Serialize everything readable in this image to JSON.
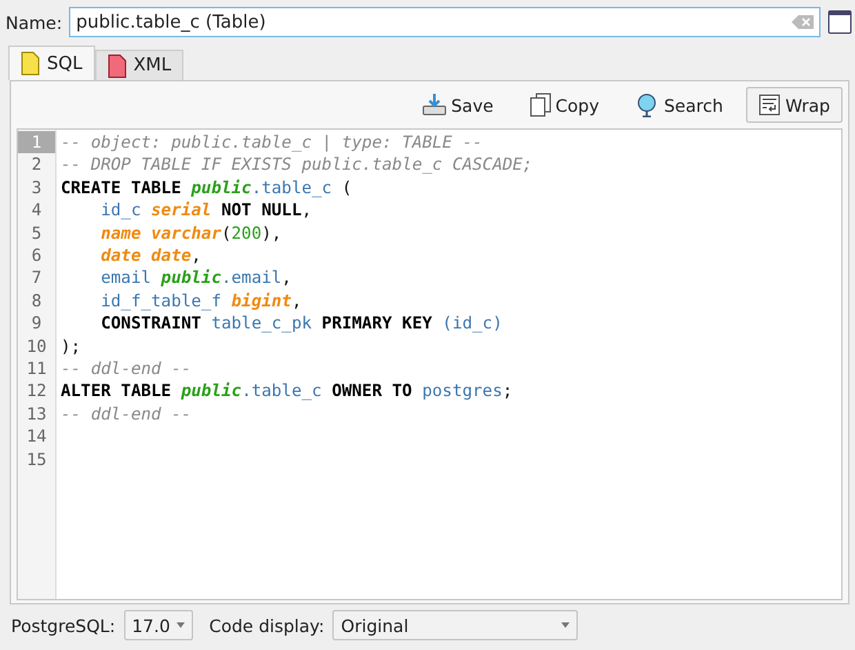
{
  "name_field": {
    "label": "Name:",
    "value": "public.table_c (Table)"
  },
  "tabs": [
    {
      "label": "SQL",
      "selected": true,
      "kind": "sql"
    },
    {
      "label": "XML",
      "selected": false,
      "kind": "xml"
    }
  ],
  "toolbar": [
    {
      "label": "Save",
      "kind": "save",
      "pressed": false
    },
    {
      "label": "Copy",
      "kind": "copy",
      "pressed": false
    },
    {
      "label": "Search",
      "kind": "search",
      "pressed": false
    },
    {
      "label": "Wrap",
      "kind": "wrap",
      "pressed": true
    }
  ],
  "code": {
    "lines": [
      {
        "number": "1",
        "selected": true,
        "tokens": [
          {
            "kind": "comment",
            "text": "-- object: public.table_c | type: TABLE --"
          }
        ]
      },
      {
        "number": "2",
        "selected": false,
        "tokens": [
          {
            "kind": "comment",
            "text": "-- DROP TABLE IF EXISTS public.table_c CASCADE;"
          }
        ]
      },
      {
        "number": "3",
        "selected": false,
        "tokens": [
          {
            "kind": "keyword",
            "text": "CREATE TABLE "
          },
          {
            "kind": "schema",
            "text": "public"
          },
          {
            "kind": "ident",
            "text": ".table_c"
          },
          {
            "kind": "plain",
            "text": " ("
          }
        ],
        "children": [
          {
            "number": "4",
            "selected": false,
            "tokens": [
              {
                "kind": "ident",
                "text": "id_c "
              },
              {
                "kind": "type",
                "text": "serial"
              },
              {
                "kind": "keyword",
                "text": " NOT NULL"
              },
              {
                "kind": "plain",
                "text": ","
              }
            ]
          },
          {
            "number": "5",
            "selected": false,
            "tokens": [
              {
                "kind": "type",
                "text": "name varchar"
              },
              {
                "kind": "plain",
                "text": "("
              },
              {
                "kind": "number",
                "text": "200"
              },
              {
                "kind": "plain",
                "text": "),"
              }
            ]
          },
          {
            "number": "6",
            "selected": false,
            "tokens": [
              {
                "kind": "type",
                "text": "date date"
              },
              {
                "kind": "plain",
                "text": ","
              }
            ]
          },
          {
            "number": "7",
            "selected": false,
            "tokens": [
              {
                "kind": "ident",
                "text": "email "
              },
              {
                "kind": "schema",
                "text": "public"
              },
              {
                "kind": "ident",
                "text": ".email"
              },
              {
                "kind": "plain",
                "text": ","
              }
            ]
          },
          {
            "number": "8",
            "selected": false,
            "tokens": [
              {
                "kind": "ident",
                "text": "id_f_table_f "
              },
              {
                "kind": "type",
                "text": "bigint"
              },
              {
                "kind": "plain",
                "text": ","
              }
            ]
          },
          {
            "number": "9",
            "selected": false,
            "tokens": [
              {
                "kind": "keyword",
                "text": "CONSTRAINT "
              },
              {
                "kind": "ident",
                "text": "table_c_pk"
              },
              {
                "kind": "keyword",
                "text": " PRIMARY KEY "
              },
              {
                "kind": "ident",
                "text": "(id_c)"
              }
            ]
          }
        ]
      },
      {
        "number": "10",
        "selected": false,
        "tokens": [
          {
            "kind": "plain",
            "text": ");"
          }
        ]
      },
      {
        "number": "11",
        "selected": false,
        "tokens": [
          {
            "kind": "comment",
            "text": "-- ddl-end --"
          }
        ]
      },
      {
        "number": "12",
        "selected": false,
        "tokens": [
          {
            "kind": "keyword",
            "text": "ALTER TABLE "
          },
          {
            "kind": "schema",
            "text": "public"
          },
          {
            "kind": "ident",
            "text": ".table_c"
          },
          {
            "kind": "keyword",
            "text": " OWNER TO "
          },
          {
            "kind": "ident",
            "text": "postgres"
          },
          {
            "kind": "plain",
            "text": ";"
          }
        ]
      },
      {
        "number": "13",
        "selected": false,
        "tokens": [
          {
            "kind": "comment",
            "text": "-- ddl-end --"
          }
        ]
      },
      {
        "number": "14",
        "selected": false
      },
      {
        "number": "15",
        "selected": false
      }
    ]
  },
  "footer": {
    "version_label": "PostgreSQL:",
    "version": "17.0",
    "display_label": "Code display:",
    "display": "Original"
  }
}
